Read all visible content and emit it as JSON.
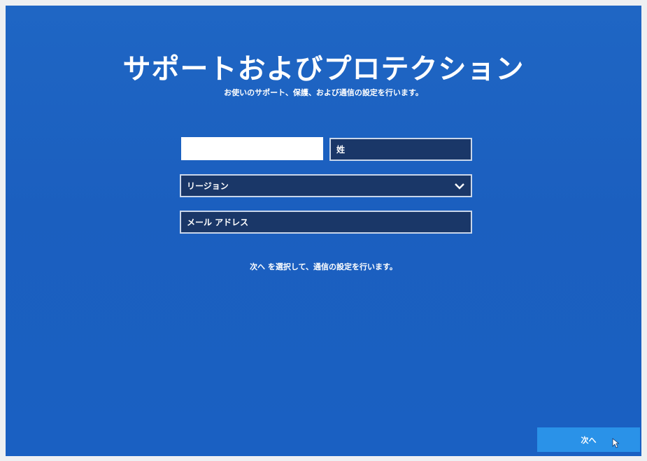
{
  "title": "サポートおよびプロテクション",
  "subtitle": "お使いのサポート、保護、および通信の設定を行います。",
  "form": {
    "first_name_value": "",
    "last_name_placeholder": "姓",
    "region_selected": "リージョン",
    "email_placeholder": "メール アドレス"
  },
  "hint": "次へ を選択して、通信の設定を行います。",
  "next_label": "次へ",
  "colors": {
    "background": "#1b5fbf",
    "field": "#1a3768",
    "button": "#2a92e8"
  },
  "icons": [
    "chevron-down-icon",
    "mouse-cursor-icon"
  ]
}
